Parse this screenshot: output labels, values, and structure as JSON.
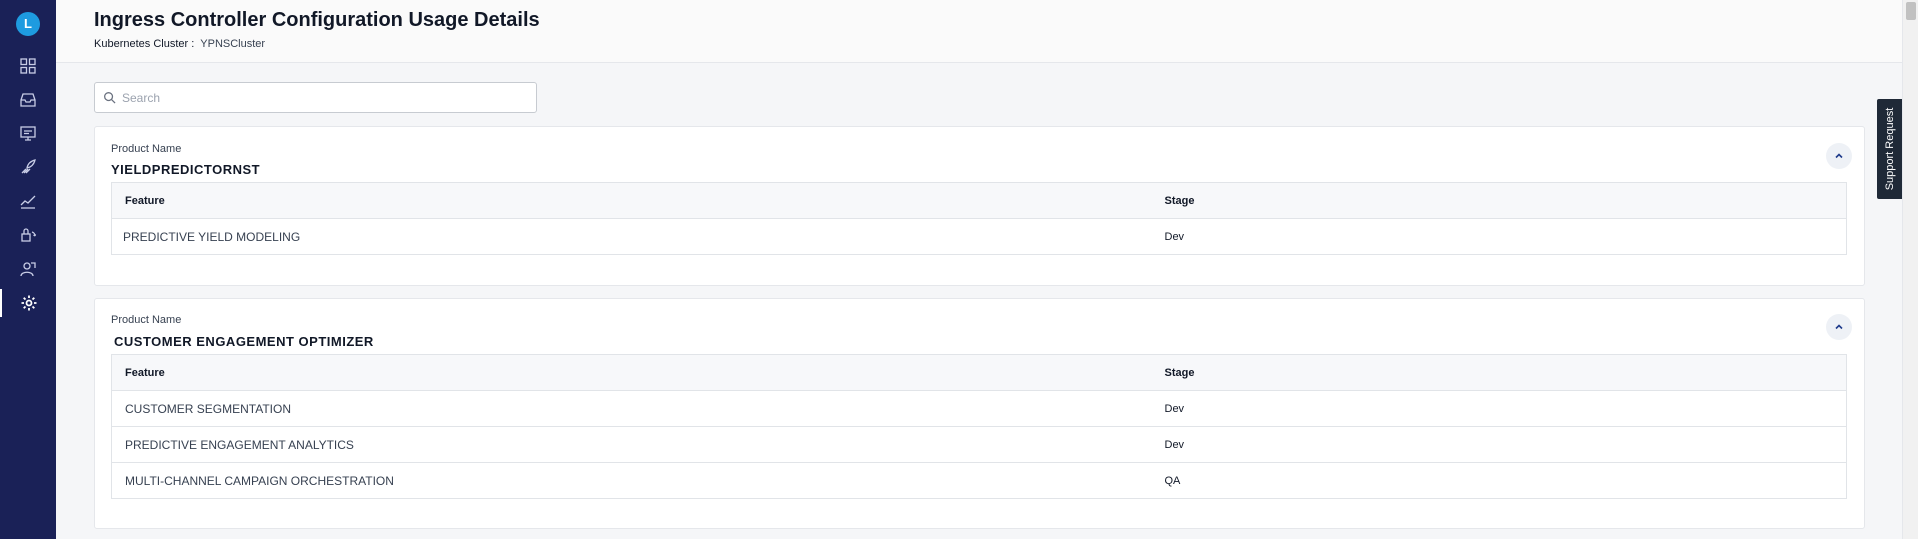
{
  "sidebar": {
    "logo_letter": "L",
    "items": [
      {
        "icon": "dashboard-grid-icon"
      },
      {
        "icon": "inbox-tray-icon"
      },
      {
        "icon": "monitor-chat-icon"
      },
      {
        "icon": "rocket-launch-icon"
      },
      {
        "icon": "trend-line-icon"
      },
      {
        "icon": "lock-refresh-icon"
      },
      {
        "icon": "person-chart-icon"
      },
      {
        "icon": "gear-icon",
        "active": true
      }
    ]
  },
  "header": {
    "title": "Ingress Controller Configuration Usage Details",
    "cluster_label": "Kubernetes Cluster :",
    "cluster_value": "YPNSCluster"
  },
  "search": {
    "placeholder": "Search",
    "value": ""
  },
  "support": {
    "label": "Support Request"
  },
  "products": [
    {
      "label": "Product Name",
      "name": "YIELDPREDICTORNST",
      "columns": {
        "feature": "Feature",
        "stage": "Stage"
      },
      "rows": [
        {
          "feature": "PREDICTIVE YIELD MODELING",
          "stage": "Dev"
        }
      ]
    },
    {
      "label": "Product Name",
      "name": "CUSTOMER ENGAGEMENT OPTIMIZER",
      "columns": {
        "feature": "Feature",
        "stage": "Stage"
      },
      "rows": [
        {
          "feature": "CUSTOMER SEGMENTATION",
          "stage": "Dev"
        },
        {
          "feature": "PREDICTIVE ENGAGEMENT ANALYTICS",
          "stage": "Dev"
        },
        {
          "feature": "MULTI-CHANNEL CAMPAIGN ORCHESTRATION",
          "stage": "QA"
        }
      ]
    }
  ],
  "colors": {
    "sidebar": "#1a2157",
    "logo": "#1e9be0",
    "accent": "#2563eb"
  }
}
